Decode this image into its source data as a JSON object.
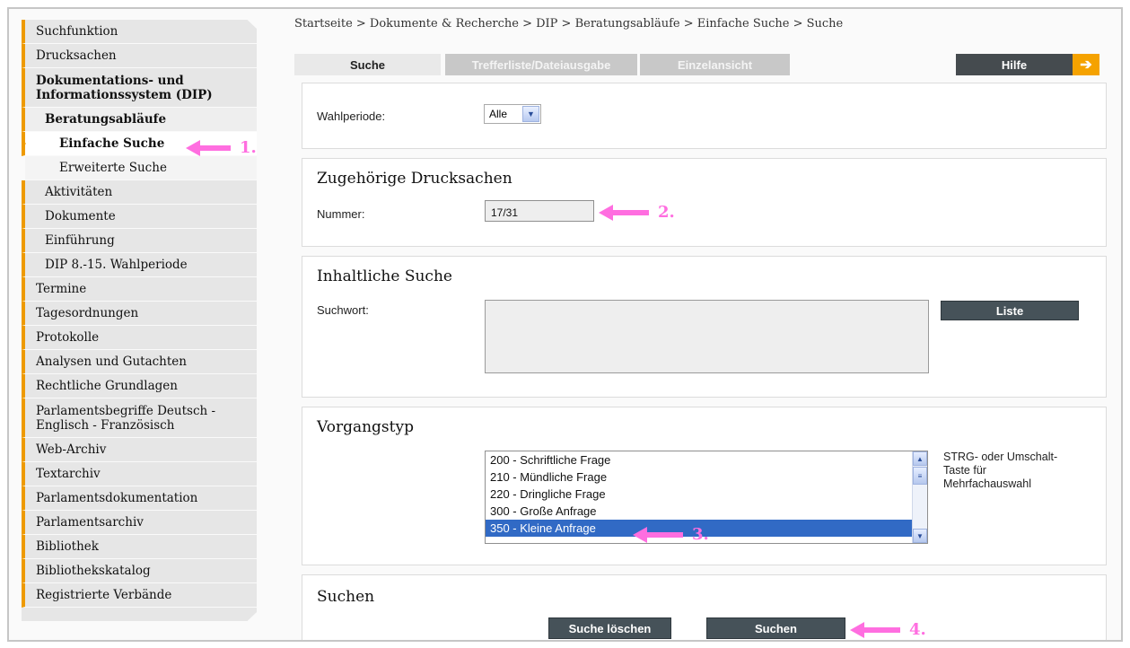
{
  "breadcrumb": "Startseite > Dokumente & Recherche > DIP > Beratungsabläufe > Einfache Suche > Suche",
  "sidebar": {
    "items": [
      "Suchfunktion",
      "Drucksachen",
      "Dokumentations- und Informationssystem (DIP)",
      "Beratungsabläufe",
      "Einfache Suche",
      "Erweiterte Suche",
      "Aktivitäten",
      "Dokumente",
      "Einführung",
      "DIP 8.-15. Wahlperiode",
      "Termine",
      "Tagesordnungen",
      "Protokolle",
      "Analysen und Gutachten",
      "Rechtliche Grundlagen",
      "Parlamentsbegriffe Deutsch - Englisch - Französisch",
      "Web-Archiv",
      "Textarchiv",
      "Parlamentsdokumentation",
      "Parlamentsarchiv",
      "Bibliothek",
      "Bibliothekskatalog",
      "Registrierte Verbände"
    ]
  },
  "tabs": {
    "suche": "Suche",
    "trefferliste": "Trefferliste/Dateiausgabe",
    "einzelansicht": "Einzelansicht",
    "hilfe": "Hilfe"
  },
  "wahlperiode": {
    "label": "Wahlperiode:",
    "value": "Alle"
  },
  "drucksachen": {
    "title": "Zugehörige Drucksachen",
    "label": "Nummer:",
    "value": "17/31"
  },
  "inhaltlich": {
    "title": "Inhaltliche Suche",
    "label": "Suchwort:",
    "button": "Liste"
  },
  "vorgangstyp": {
    "title": "Vorgangstyp",
    "options": [
      "200 - Schriftliche Frage",
      "210 - Mündliche Frage",
      "220 - Dringliche Frage",
      "300 - Große Anfrage",
      "350 - Kleine Anfrage"
    ],
    "selected_index": 4,
    "hint": "STRG- oder Umschalt-Taste für Mehrfachauswahl"
  },
  "suchen": {
    "title": "Suchen",
    "clear_button": "Suche löschen",
    "search_button": "Suchen"
  },
  "annotations": [
    "1.",
    "2.",
    "3.",
    "4."
  ],
  "colors": {
    "accent": "#ee9a00",
    "annotation": "#ff6ee0",
    "button": "#465259",
    "selection": "#316ac5"
  }
}
